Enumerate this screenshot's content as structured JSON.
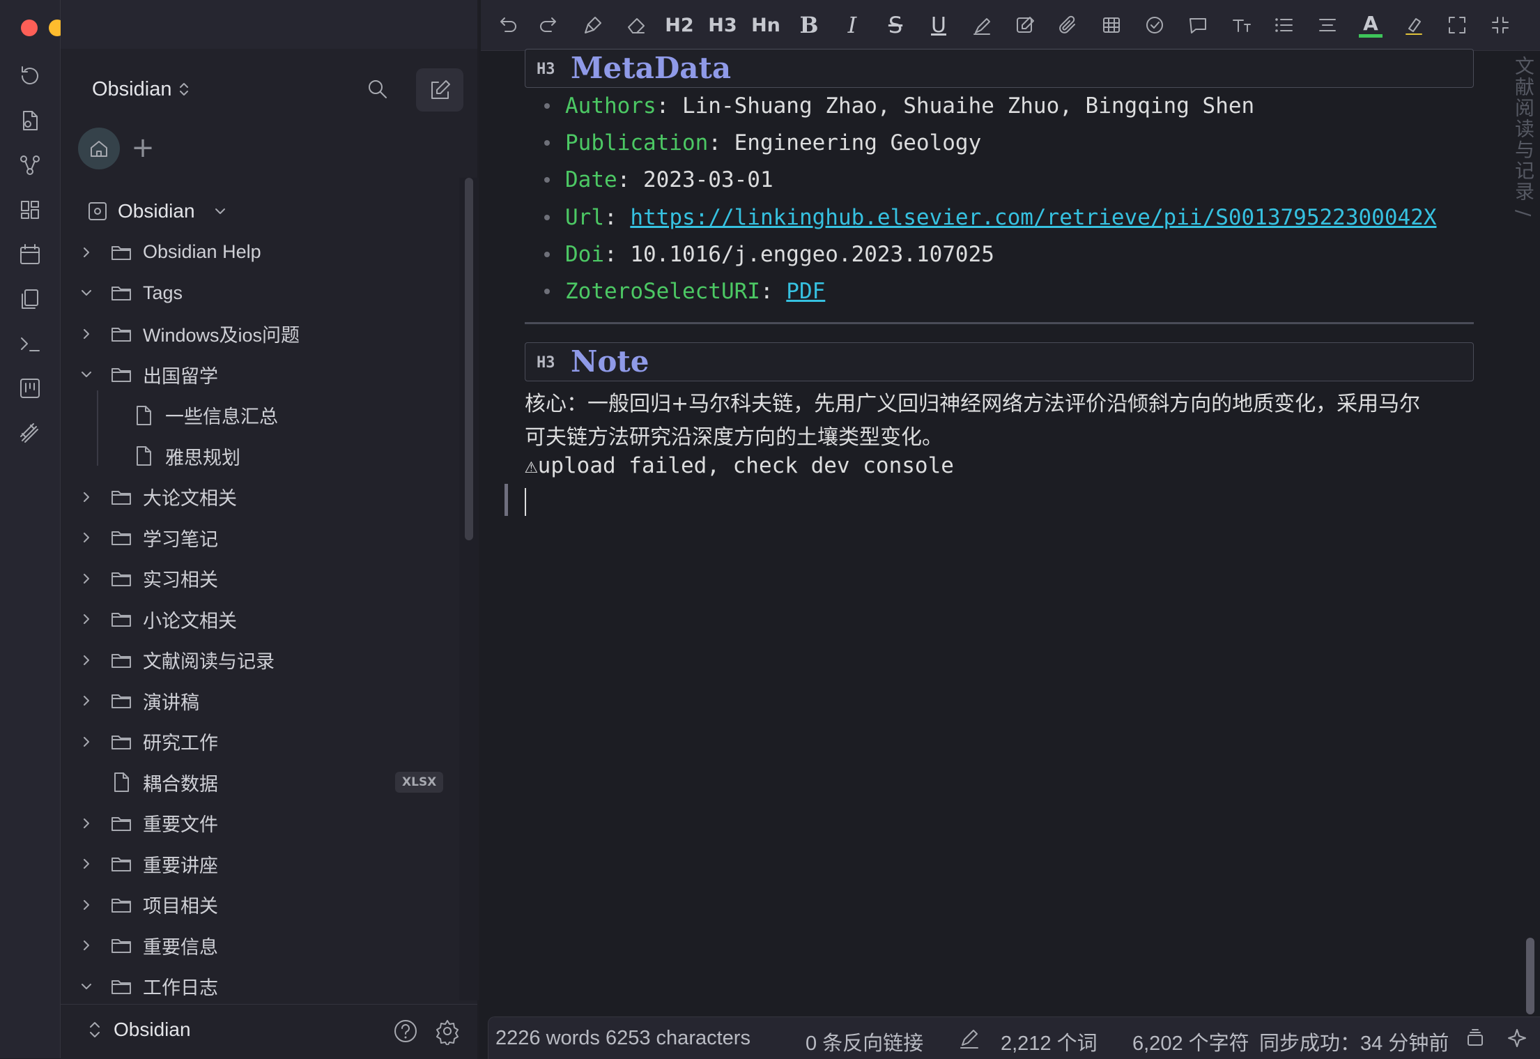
{
  "ribbon": {
    "icons": [
      "undo-history-icon",
      "file-recovery-icon",
      "graph-icon",
      "canvas-grid-icon",
      "calendar-icon",
      "copy-pages-icon",
      "terminal-icon",
      "kanban-icon",
      "excalidraw-icon"
    ]
  },
  "sidebar": {
    "vault_name": "Obsidian",
    "root_label": "Obsidian",
    "tree": [
      {
        "label": "Obsidian Help",
        "type": "folder",
        "expanded": false,
        "depth": 0
      },
      {
        "label": "Tags",
        "type": "folder",
        "expanded": true,
        "depth": 0
      },
      {
        "label": "Windows及ios问题",
        "type": "folder",
        "expanded": false,
        "depth": 0
      },
      {
        "label": "出国留学",
        "type": "folder",
        "expanded": true,
        "depth": 0
      },
      {
        "label": "一些信息汇总",
        "type": "file",
        "depth": 1
      },
      {
        "label": "雅思规划",
        "type": "file",
        "depth": 1
      },
      {
        "label": "大论文相关",
        "type": "folder",
        "expanded": false,
        "depth": 0
      },
      {
        "label": "学习笔记",
        "type": "folder",
        "expanded": false,
        "depth": 0
      },
      {
        "label": "实习相关",
        "type": "folder",
        "expanded": false,
        "depth": 0
      },
      {
        "label": "小论文相关",
        "type": "folder",
        "expanded": false,
        "depth": 0
      },
      {
        "label": "文献阅读与记录",
        "type": "folder",
        "expanded": false,
        "depth": 0
      },
      {
        "label": "演讲稿",
        "type": "folder",
        "expanded": false,
        "depth": 0
      },
      {
        "label": "研究工作",
        "type": "folder",
        "expanded": false,
        "depth": 0
      },
      {
        "label": "耦合数据",
        "type": "file",
        "badge": "XLSX",
        "depth": 0
      },
      {
        "label": "重要文件",
        "type": "folder",
        "expanded": false,
        "depth": 0
      },
      {
        "label": "重要讲座",
        "type": "folder",
        "expanded": false,
        "depth": 0
      },
      {
        "label": "项目相关",
        "type": "folder",
        "expanded": false,
        "depth": 0
      },
      {
        "label": "重要信息",
        "type": "folder",
        "expanded": false,
        "depth": 0
      },
      {
        "label": "工作日志",
        "type": "folder",
        "expanded": true,
        "depth": 0
      }
    ],
    "footer_vault": "Obsidian"
  },
  "toolbar": {
    "h2_label": "H2",
    "h3_label": "H3",
    "hn_label": "Hn",
    "bold_label": "B",
    "italic_label": "I",
    "strike_label": "S",
    "underline_label": "U",
    "font_color_label": "A",
    "font_color": "#3ec45a"
  },
  "editor": {
    "vertical_title": "文献阅读与记录 /",
    "metadata_heading_tag": "H3",
    "metadata_heading": "MetaData",
    "metadata": [
      {
        "key": "Authors",
        "sep": ": ",
        "value": "Lin-Shuang Zhao, Shuaihe Zhuo, Bingqing Shen",
        "link": false
      },
      {
        "key": "Publication",
        "sep": ": ",
        "value": "Engineering Geology",
        "link": false
      },
      {
        "key": "Date",
        "sep": ": ",
        "value": "2023-03-01",
        "link": false
      },
      {
        "key": "Url",
        "sep": ": ",
        "value": "https://linkinghub.elsevier.com/retrieve/pii/S001379522300042X",
        "link": true
      },
      {
        "key": "Doi",
        "sep": ": ",
        "value": "10.1016/j.enggeo.2023.107025",
        "link": false
      },
      {
        "key": "ZoteroSelectURI",
        "sep": ": ",
        "value": "PDF",
        "link": true
      }
    ],
    "note_heading_tag": "H3",
    "note_heading": "Note",
    "note_line1": "核心：一般回归+马尔科夫链，先用广义回归神经网络方法评价沿倾斜方向的地质变化，采用马尔",
    "note_line2": "可夫链方法研究沿深度方向的土壤类型变化。",
    "upload_message": "⚠upload failed, check dev console"
  },
  "statusbar": {
    "word_count": "2226 words 6253 characters",
    "backlinks": "0 条反向链接",
    "cn_words": "2,212 个词",
    "cn_chars": "6,202 个字符",
    "sync_status": "同步成功：34 分钟前"
  },
  "colors": {
    "accent_green": "#4cc864",
    "link_cyan": "#36c1e0",
    "heading_purple": "#8f9ae8",
    "traffic_red": "#fe5f57",
    "traffic_yellow": "#febc2e",
    "traffic_green": "#28c840"
  }
}
